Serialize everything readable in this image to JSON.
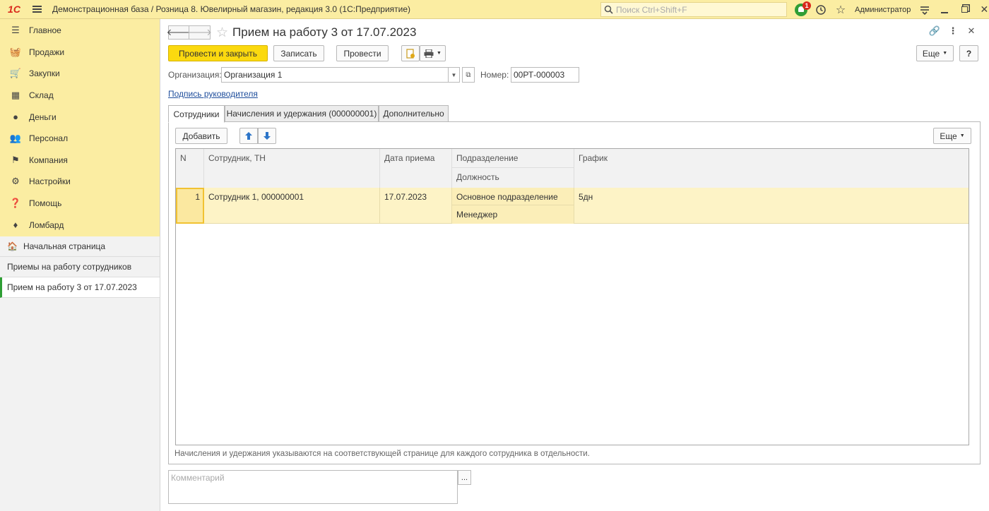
{
  "topbar": {
    "logo": "1С",
    "title": "Демонстрационная база / Розница 8. Ювелирный магазин, редакция 3.0  (1С:Предприятие)",
    "search_placeholder": "Поиск Ctrl+Shift+F",
    "notifications_count": "1",
    "user": "Администратор"
  },
  "sidebar": {
    "menu": [
      {
        "label": "Главное",
        "icon": "list-icon"
      },
      {
        "label": "Продажи",
        "icon": "basket-icon"
      },
      {
        "label": "Закупки",
        "icon": "cart-icon"
      },
      {
        "label": "Склад",
        "icon": "grid-icon"
      },
      {
        "label": "Деньги",
        "icon": "money-icon"
      },
      {
        "label": "Персонал",
        "icon": "people-icon"
      },
      {
        "label": "Компания",
        "icon": "flag-icon"
      },
      {
        "label": "Настройки",
        "icon": "gear-icon"
      },
      {
        "label": "Помощь",
        "icon": "help-icon"
      },
      {
        "label": "Ломбард",
        "icon": "diamond-icon"
      }
    ],
    "home": "Начальная страница",
    "nav": [
      "Приемы на работу сотрудников",
      "Прием на работу 3 от 17.07.2023"
    ]
  },
  "document": {
    "title": "Прием на работу 3 от 17.07.2023",
    "buttons": {
      "post_close": "Провести и закрыть",
      "save": "Записать",
      "post": "Провести",
      "more": "Еще",
      "help": "?"
    },
    "organization_label": "Организация:",
    "organization_value": "Организация 1",
    "number_label": "Номер:",
    "number_value": "00РТ-000003",
    "signature_link": "Подпись руководителя",
    "tabs": [
      "Сотрудники",
      "Начисления и удержания (000000001)",
      "Дополнительно"
    ],
    "table_buttons": {
      "add": "Добавить",
      "more": "Еще"
    },
    "table": {
      "headers": {
        "n": "N",
        "employee": "Сотрудник, ТН",
        "hire_date": "Дата приема",
        "division": "Подразделение",
        "position": "Должность",
        "schedule": "График"
      },
      "rows": [
        {
          "n": "1",
          "employee": "Сотрудник 1, 000000001",
          "hire_date": "17.07.2023",
          "division": "Основное подразделение",
          "position": "Менеджер",
          "schedule": "5дн"
        }
      ]
    },
    "note": "Начисления и удержания указываются на соответствующей странице для каждого сотрудника в отдельности.",
    "comment_placeholder": "Комментарий",
    "comment_button": "..."
  },
  "colors": {
    "accent_yellow": "#fbd90f",
    "panel_yellow": "#fbeda2",
    "row_highlight": "#fdf3c6",
    "brand_red": "#d9291c",
    "link_blue": "#1f4e9c"
  }
}
